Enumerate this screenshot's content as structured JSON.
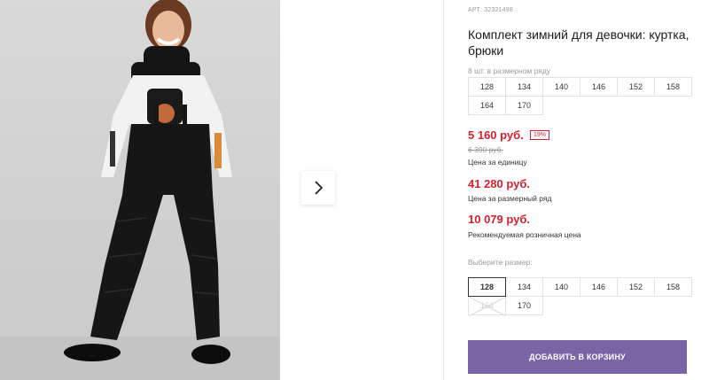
{
  "product": {
    "article": "АРТ: 32321498",
    "title": "Комплект зимний для девочки: куртка, брюки",
    "pack_note": "8 шт. в размерном ряду",
    "pack_sizes": [
      "128",
      "134",
      "140",
      "146",
      "152",
      "158",
      "164",
      "170"
    ],
    "price": "5 160 руб.",
    "discount": "19%",
    "old_price": "6 390 руб.",
    "unit_price_label": "Цена за единицу",
    "row_price": "41 280 руб.",
    "row_price_label": "Цена за размерный ряд",
    "rrp": "10 079 руб.",
    "rrp_label": "Рекомендуемая розничная цена",
    "choose_size_label": "Выберите размер:",
    "sizes": [
      {
        "label": "128",
        "state": "selected"
      },
      {
        "label": "134",
        "state": "available"
      },
      {
        "label": "140",
        "state": "available"
      },
      {
        "label": "146",
        "state": "available"
      },
      {
        "label": "152",
        "state": "available"
      },
      {
        "label": "158",
        "state": "available"
      },
      {
        "label": "164",
        "state": "unavailable"
      },
      {
        "label": "170",
        "state": "available"
      }
    ],
    "add_to_cart": "ДОБАВИТЬ В КОРЗИНУ"
  },
  "gallery": {
    "next_icon": "chevron-right-icon"
  },
  "colors": {
    "price_red": "#d3222f",
    "button_purple": "#7a64a6"
  }
}
